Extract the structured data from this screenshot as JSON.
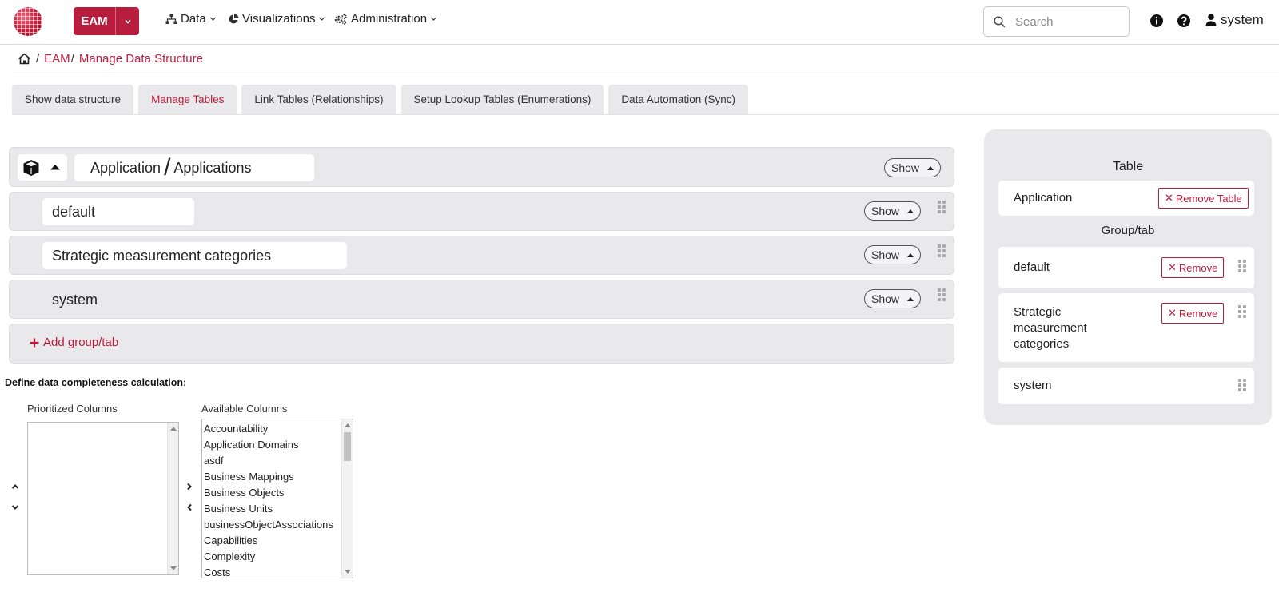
{
  "header": {
    "app_name": "EAM",
    "nav": [
      {
        "label": "Data",
        "icon": "sitemap-icon"
      },
      {
        "label": "Visualizations",
        "icon": "pie-chart-icon"
      },
      {
        "label": "Administration",
        "icon": "gears-icon"
      }
    ],
    "search_placeholder": "Search",
    "user_name": "system"
  },
  "breadcrumb": {
    "home_icon": "home-icon",
    "items": [
      "EAM",
      "Manage Data Structure"
    ]
  },
  "tabs": [
    {
      "label": "Show data structure",
      "active": false
    },
    {
      "label": "Manage Tables",
      "active": true
    },
    {
      "label": "Link Tables (Relationships)",
      "active": false
    },
    {
      "label": "Setup Lookup Tables (Enumerations)",
      "active": false
    },
    {
      "label": "Data Automation (Sync)",
      "active": false
    }
  ],
  "table_panel": {
    "icon": "cube-icon",
    "singular_name": "Application",
    "plural_name": "Applications",
    "show_label": "Show"
  },
  "groups": [
    {
      "name": "default",
      "show_label": "Show"
    },
    {
      "name": "Strategic measurement categories",
      "show_label": "Show"
    },
    {
      "name": "system",
      "show_label": "Show"
    }
  ],
  "add_group_label": "Add group/tab",
  "completeness": {
    "title": "Define data completeness calculation:",
    "prioritized_label": "Prioritized Columns",
    "available_label": "Available Columns",
    "prioritized_columns": [],
    "available_columns": [
      "Accountability",
      "Application Domains",
      "asdf",
      "Business Mappings",
      "Business Objects",
      "Business Units",
      "businessObjectAssociations",
      "Capabilities",
      "Complexity",
      "Costs"
    ]
  },
  "side_panel": {
    "table_heading": "Table",
    "table_name": "Application",
    "remove_table_label": "Remove Table",
    "group_heading": "Group/tab",
    "groups": [
      {
        "lines": [
          "default"
        ],
        "remove_label": "Remove"
      },
      {
        "lines": [
          "Strategic",
          "measurement",
          "categories"
        ],
        "remove_label": "Remove"
      },
      {
        "lines": [
          "system"
        ],
        "remove_label": ""
      }
    ]
  },
  "colors": {
    "brand": "#b81d3e",
    "panel_bg": "#e9e9ec"
  }
}
